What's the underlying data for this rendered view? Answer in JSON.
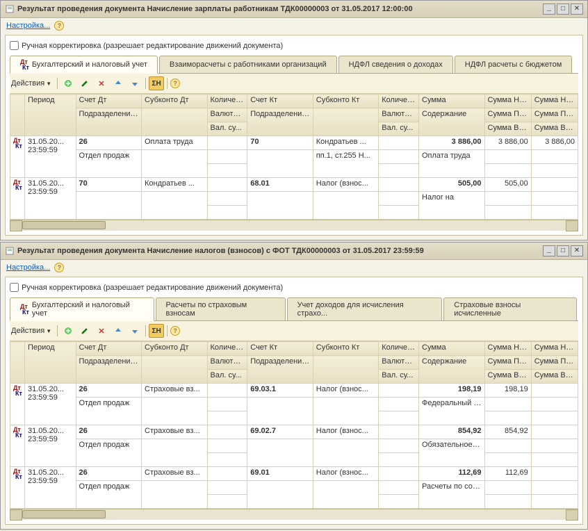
{
  "win1": {
    "title": "Результат проведения документа Начисление зарплаты работникам ТДК00000003 от 31.05.2017 12:00:00",
    "settings": "Настройка...",
    "checkbox": "Ручная корректировка (разрешает редактирование движений документа)",
    "tabs": [
      "Бухгалтерский и налоговый учет",
      "Взаиморасчеты с работниками организаций",
      "НДФЛ сведения о доходах",
      "НДФЛ расчеты с бюджетом"
    ],
    "actions": "Действия",
    "headers": {
      "period": "Период",
      "schetDt": "Счет Дт",
      "subDt": "Субконто Дт",
      "qtyDt": "Количес...",
      "podrDt": "Подразделение Дт",
      "valDt": "Валюта ...",
      "valSumDt": "Вал. су...",
      "schetKt": "Счет Кт",
      "subKt": "Субконто Кт",
      "qtyKt": "Количес...",
      "podrKt": "Подразделение Кт",
      "valKt": "Валюта ...",
      "valSumKt": "Вал. су...",
      "summa": "Сумма",
      "soder": "Содержание",
      "sNuDt": "Сумма НУ ...",
      "sNuKt": "Сумма НУ Кт",
      "sPrDt": "Сумма ПР ...",
      "sPrKt": "Сумма ПР Кт",
      "sVrDt": "Сумма ВР ...",
      "sVrKt": "Сумма ВР Кт"
    },
    "rows": [
      {
        "date": "31.05.20...",
        "time": "23:59:59",
        "schetDt": "26",
        "podrDt": "Отдел продаж",
        "subDt": "Оплата труда",
        "schetKt": "70",
        "subKt": "Кондратьев ...",
        "subKt2": "пп.1, ст.255 Н...",
        "summa": "3 886,00",
        "soder": "Оплата труда",
        "nuDt": "3 886,00",
        "nuKt": "3 886,00"
      },
      {
        "date": "31.05.20...",
        "time": "23:59:59",
        "schetDt": "70",
        "podrDt": "",
        "subDt": "Кондратьев ...",
        "schetKt": "68.01",
        "subKt": "Налог (взнос...",
        "subKt2": "",
        "summa": "505,00",
        "soder": "Налог на",
        "nuDt": "505,00",
        "nuKt": ""
      }
    ]
  },
  "win2": {
    "title": "Результат проведения документа Начисление налогов (взносов) с ФОТ ТДК00000003 от 31.05.2017 23:59:59",
    "settings": "Настройка...",
    "checkbox": "Ручная корректировка (разрешает редактирование движений документа)",
    "tabs": [
      "Бухгалтерский и налоговый учет",
      "Расчеты по страховым взносам",
      "Учет доходов для исчисления страхо...",
      "Страховые взносы исчисленные"
    ],
    "actions": "Действия",
    "headers": {
      "period": "Период",
      "schetDt": "Счет Дт",
      "subDt": "Субконто Дт",
      "qtyDt": "Количес...",
      "podrDt": "Подразделение Дт",
      "valDt": "Валюта ...",
      "valSumDt": "Вал. су...",
      "schetKt": "Счет Кт",
      "subKt": "Субконто Кт",
      "qtyKt": "Количес...",
      "podrKt": "Подразделение Кт",
      "valKt": "Валюта ...",
      "valSumKt": "Вал. су...",
      "summa": "Сумма",
      "soder": "Содержание",
      "sNuDt": "Сумма НУ ...",
      "sNuKt": "Сумма НУ Кт",
      "sPrDt": "Сумма ПР ...",
      "sPrKt": "Сумма ПР Кт",
      "sVrDt": "Сумма ВР ...",
      "sVrKt": "Сумма ВР Кт"
    },
    "rows": [
      {
        "date": "31.05.20...",
        "time": "23:59:59",
        "schetDt": "26",
        "podrDt": "Отдел продаж",
        "subDt": "Страховые вз...",
        "schetKt": "69.03.1",
        "subKt": "Налог (взнос...",
        "summa": "198,19",
        "soder": "Федеральный фонд ОМС",
        "nuDt": "198,19"
      },
      {
        "date": "31.05.20...",
        "time": "23:59:59",
        "schetDt": "26",
        "podrDt": "Отдел продаж",
        "subDt": "Страховые вз...",
        "schetKt": "69.02.7",
        "subKt": "Налог (взнос...",
        "summa": "854,92",
        "soder": "Обязательное пенсионное ...",
        "nuDt": "854,92"
      },
      {
        "date": "31.05.20...",
        "time": "23:59:59",
        "schetDt": "26",
        "podrDt": "Отдел продаж",
        "subDt": "Страховые вз...",
        "schetKt": "69.01",
        "subKt": "Налог (взнос...",
        "summa": "112,69",
        "soder": "Расчеты по социальному ...",
        "nuDt": "112,69"
      }
    ]
  }
}
